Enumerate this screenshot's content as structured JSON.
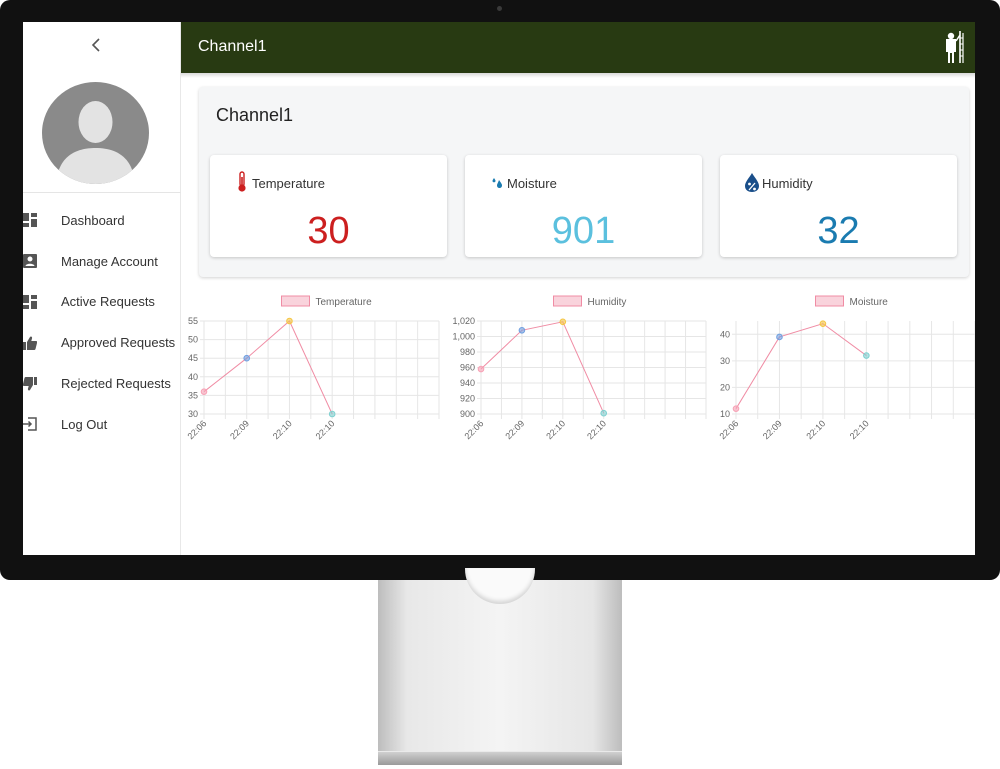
{
  "topbar": {
    "title": "Channel1",
    "worker_icon": "worker-icon"
  },
  "sidebar": {
    "collapse_icon": "chevron-left-icon",
    "items": [
      {
        "label": "Dashboard",
        "icon": "dashboard-icon"
      },
      {
        "label": "Manage Account",
        "icon": "account-icon"
      },
      {
        "label": "Active Requests",
        "icon": "dashboard-icon"
      },
      {
        "label": "Approved Requests",
        "icon": "thumbs-up-icon"
      },
      {
        "label": "Rejected Requests",
        "icon": "thumbs-down-icon"
      },
      {
        "label": "Log Out",
        "icon": "logout-icon"
      }
    ]
  },
  "panel": {
    "title": "Channel1",
    "cards": [
      {
        "label": "Temperature",
        "value": "30",
        "color": "#cc1f1f",
        "icon": "thermometer-icon"
      },
      {
        "label": "Moisture",
        "value": "901",
        "color": "#5bc0de",
        "icon": "droplets-icon"
      },
      {
        "label": "Humidity",
        "value": "32",
        "color": "#1a7bb0",
        "icon": "percent-drop-icon"
      }
    ]
  },
  "chart_data": [
    {
      "type": "line",
      "title": "",
      "categories": [
        "22:06",
        "22:09",
        "22:10",
        "22:10"
      ],
      "series": [
        {
          "name": "Temperature",
          "values": [
            36,
            45,
            55,
            30
          ]
        }
      ],
      "ylim": [
        30,
        55
      ],
      "yticks": [
        "55",
        "50",
        "45",
        "40",
        "35",
        "30"
      ],
      "grid": true,
      "legend": "top-center",
      "point_colors": [
        "#f7a1b5",
        "#6f9fe0",
        "#f5c542",
        "#7fd0d0"
      ]
    },
    {
      "type": "line",
      "title": "",
      "categories": [
        "22:06",
        "22:09",
        "22:10",
        "22:10"
      ],
      "series": [
        {
          "name": "Humidity",
          "values": [
            958,
            1008,
            1019,
            901
          ]
        }
      ],
      "ylim": [
        900,
        1020
      ],
      "yticks": [
        "1,020",
        "1,000",
        "980",
        "960",
        "940",
        "920",
        "900"
      ],
      "grid": true,
      "legend": "top-center",
      "point_colors": [
        "#f7a1b5",
        "#6f9fe0",
        "#f5c542",
        "#7fd0d0"
      ]
    },
    {
      "type": "line",
      "title": "",
      "categories": [
        "22:06",
        "22:09",
        "22:10",
        "22:10"
      ],
      "series": [
        {
          "name": "Moisture",
          "values": [
            12,
            39,
            44,
            32
          ]
        }
      ],
      "ylim": [
        10,
        45
      ],
      "yticks": [
        "40",
        "30",
        "20",
        "10"
      ],
      "grid": true,
      "legend": "top-center",
      "point_colors": [
        "#f7a1b5",
        "#6f9fe0",
        "#f5c542",
        "#7fd0d0"
      ]
    }
  ],
  "colors": {
    "topbar": "#283a12",
    "line": "#f08ca4",
    "legend_fill": "#f9d3dc"
  }
}
